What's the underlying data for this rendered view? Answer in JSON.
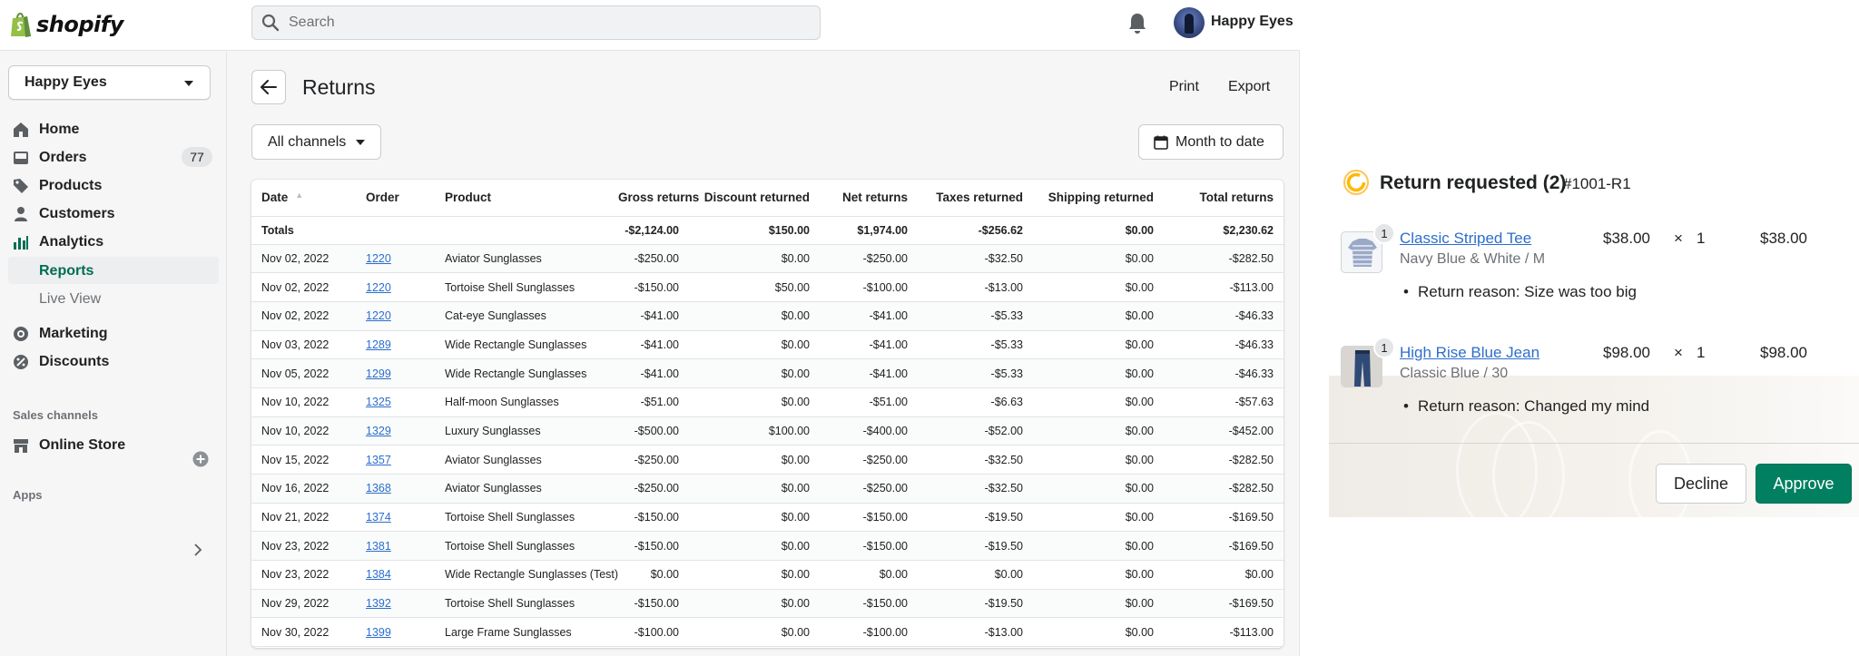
{
  "topbar": {
    "brand": "shopify",
    "search_placeholder": "Search",
    "user_name": "Happy Eyes"
  },
  "sidebar": {
    "store_name": "Happy Eyes",
    "items": [
      {
        "label": "Home",
        "icon": "home-icon"
      },
      {
        "label": "Orders",
        "icon": "orders-icon",
        "badge": "77"
      },
      {
        "label": "Products",
        "icon": "tag-icon"
      },
      {
        "label": "Customers",
        "icon": "person-icon"
      },
      {
        "label": "Analytics",
        "icon": "bar-chart-icon"
      }
    ],
    "analytics_sub": [
      "Reports",
      "Live View"
    ],
    "items2": [
      {
        "label": "Marketing",
        "icon": "marketing-icon"
      },
      {
        "label": "Discounts",
        "icon": "discount-icon"
      }
    ],
    "sales_channels_label": "Sales channels",
    "online_store_label": "Online Store",
    "apps_label": "Apps"
  },
  "page": {
    "title": "Returns",
    "print_label": "Print",
    "export_label": "Export",
    "channel_filter": "All channels",
    "date_filter": "Month to date"
  },
  "table": {
    "columns": [
      "Date",
      "Order",
      "Product",
      "Gross returns",
      "Discount returned",
      "Net returns",
      "Taxes returned",
      "Shipping returned",
      "Total returns"
    ],
    "totals": [
      "Totals",
      "",
      "",
      "-$2,124.00",
      "$150.00",
      "$1,974.00",
      "-$256.62",
      "$0.00",
      "$2,230.62"
    ],
    "rows": [
      [
        "Nov 02, 2022",
        "1220",
        "Aviator Sunglasses",
        "-$250.00",
        "$0.00",
        "-$250.00",
        "-$32.50",
        "$0.00",
        "-$282.50"
      ],
      [
        "Nov 02, 2022",
        "1220",
        "Tortoise Shell Sunglasses",
        "-$150.00",
        "$50.00",
        "-$100.00",
        "-$13.00",
        "$0.00",
        "-$113.00"
      ],
      [
        "Nov 02, 2022",
        "1220",
        "Cat-eye Sunglasses",
        "-$41.00",
        "$0.00",
        "-$41.00",
        "-$5.33",
        "$0.00",
        "-$46.33"
      ],
      [
        "Nov 03, 2022",
        "1289",
        "Wide Rectangle Sunglasses",
        "-$41.00",
        "$0.00",
        "-$41.00",
        "-$5.33",
        "$0.00",
        "-$46.33"
      ],
      [
        "Nov 05, 2022",
        "1299",
        "Wide Rectangle Sunglasses",
        "-$41.00",
        "$0.00",
        "-$41.00",
        "-$5.33",
        "$0.00",
        "-$46.33"
      ],
      [
        "Nov 10, 2022",
        "1325",
        "Half-moon Sunglasses",
        "-$51.00",
        "$0.00",
        "-$51.00",
        "-$6.63",
        "$0.00",
        "-$57.63"
      ],
      [
        "Nov 10, 2022",
        "1329",
        "Luxury Sunglasses",
        "-$500.00",
        "$100.00",
        "-$400.00",
        "-$52.00",
        "$0.00",
        "-$452.00"
      ],
      [
        "Nov 15, 2022",
        "1357",
        "Aviator Sunglasses",
        "-$250.00",
        "$0.00",
        "-$250.00",
        "-$32.50",
        "$0.00",
        "-$282.50"
      ],
      [
        "Nov 16, 2022",
        "1368",
        "Aviator Sunglasses",
        "-$250.00",
        "$0.00",
        "-$250.00",
        "-$32.50",
        "$0.00",
        "-$282.50"
      ],
      [
        "Nov 21, 2022",
        "1374",
        "Tortoise Shell Sunglasses",
        "-$150.00",
        "$0.00",
        "-$150.00",
        "-$19.50",
        "$0.00",
        "-$169.50"
      ],
      [
        "Nov 23, 2022",
        "1381",
        "Tortoise Shell Sunglasses",
        "-$150.00",
        "$0.00",
        "-$150.00",
        "-$19.50",
        "$0.00",
        "-$169.50"
      ],
      [
        "Nov 23, 2022",
        "1384",
        "Wide Rectangle Sunglasses (Test)",
        "$0.00",
        "$0.00",
        "$0.00",
        "$0.00",
        "$0.00",
        "$0.00"
      ],
      [
        "Nov 29, 2022",
        "1392",
        "Tortoise Shell Sunglasses",
        "-$150.00",
        "$0.00",
        "-$150.00",
        "-$19.50",
        "$0.00",
        "-$169.50"
      ],
      [
        "Nov 30, 2022",
        "1399",
        "Large Frame Sunglasses",
        "-$100.00",
        "$0.00",
        "-$100.00",
        "-$13.00",
        "$0.00",
        "-$113.00"
      ]
    ]
  },
  "return_panel": {
    "title": "Return requested (2)",
    "return_id": "#1001-R1",
    "items": [
      {
        "qty_badge": "1",
        "name": "Classic Striped Tee",
        "variant": "Navy Blue & White / M",
        "price": "$38.00",
        "times": "×",
        "qty": "1",
        "total": "$38.00",
        "reason": "Return reason: Size was too big"
      },
      {
        "qty_badge": "1",
        "name": "High Rise Blue Jean",
        "variant": "Classic Blue / 30",
        "price": "$98.00",
        "times": "×",
        "qty": "1",
        "total": "$98.00",
        "reason": "Return reason: Changed my mind"
      }
    ],
    "decline_label": "Decline",
    "approve_label": "Approve"
  },
  "colors": {
    "accent_green": "#008060",
    "active_nav": "#006e52",
    "link_blue": "#2c6ecb",
    "pending_yellow": "#ffb800"
  }
}
